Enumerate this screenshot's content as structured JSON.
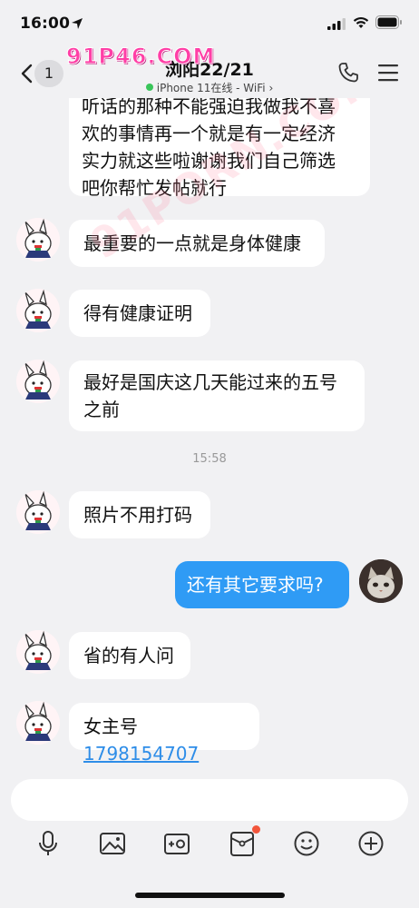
{
  "status_bar": {
    "time": "16:00"
  },
  "header": {
    "unread_count": "1",
    "title": "浏阳22/21",
    "subtitle": "iPhone 11在线 - WiFi",
    "subtitle_chevron": "›"
  },
  "watermark": {
    "text": "91P46.COM",
    "diagonal": "91PORN.COM"
  },
  "messages": [
    {
      "direction": "in",
      "text_lines": [
        "听话的那种不能强迫我做我不喜",
        "欢的事情再一个就是有一定经济",
        "实力就这些啦谢谢我们自己筛选",
        "吧你帮忙发帖就行"
      ]
    },
    {
      "direction": "in",
      "text": "最重要的一点就是身体健康"
    },
    {
      "direction": "in",
      "text": "得有健康证明"
    },
    {
      "direction": "in",
      "text_lines": [
        "最好是国庆这几天能过来的五号",
        "之前"
      ]
    },
    {
      "direction": "in",
      "text": "照片不用打码"
    },
    {
      "direction": "out",
      "text": "还有其它要求吗?"
    },
    {
      "direction": "in",
      "text": "省的有人问"
    },
    {
      "direction": "in",
      "prefix": "女主号 ",
      "link": "1798154707"
    }
  ],
  "time_separator": "15:58",
  "input": {
    "placeholder": ""
  },
  "toolbar_icons": [
    "microphone-icon",
    "image-icon",
    "camera-icon",
    "red-packet-icon",
    "emoji-icon",
    "plus-icon"
  ],
  "colors": {
    "accent": "#2f9bf5",
    "background": "#f1f1f3",
    "bubble_in": "#ffffff",
    "link": "#2e8de8",
    "online": "#39c55a",
    "badge": "#f2553b"
  }
}
